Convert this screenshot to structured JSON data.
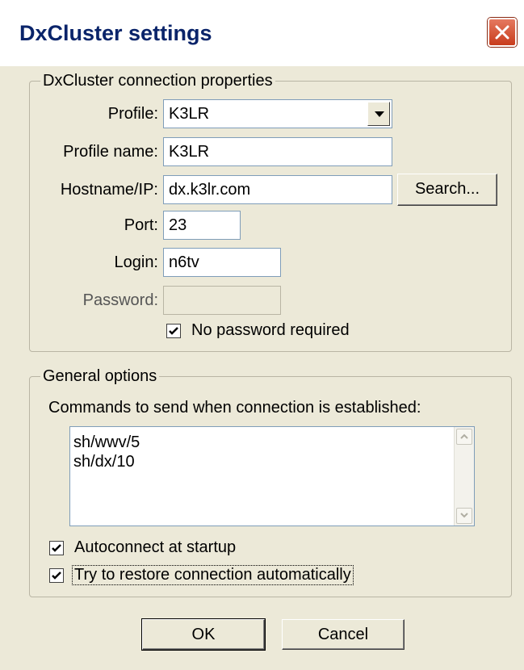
{
  "window": {
    "title": "DxCluster settings"
  },
  "connection_group": {
    "legend": "DxCluster connection properties",
    "profile_label": "Profile:",
    "profile_value": "K3LR",
    "profile_name_label": "Profile name:",
    "profile_name_value": "K3LR",
    "hostname_label": "Hostname/IP:",
    "hostname_value": "dx.k3lr.com",
    "search_button": "Search...",
    "port_label": "Port:",
    "port_value": "23",
    "login_label": "Login:",
    "login_value": "n6tv",
    "password_label": "Password:",
    "password_value": "",
    "no_password_label": "No password required",
    "no_password_checked": true
  },
  "general_group": {
    "legend": "General options",
    "commands_label": "Commands to send when connection is established:",
    "commands": [
      "sh/wwv/5",
      "sh/dx/10"
    ],
    "autoconnect_label": "Autoconnect at startup",
    "autoconnect_checked": true,
    "restore_label": "Try to restore connection automatically",
    "restore_checked": true
  },
  "buttons": {
    "ok": "OK",
    "cancel": "Cancel"
  }
}
